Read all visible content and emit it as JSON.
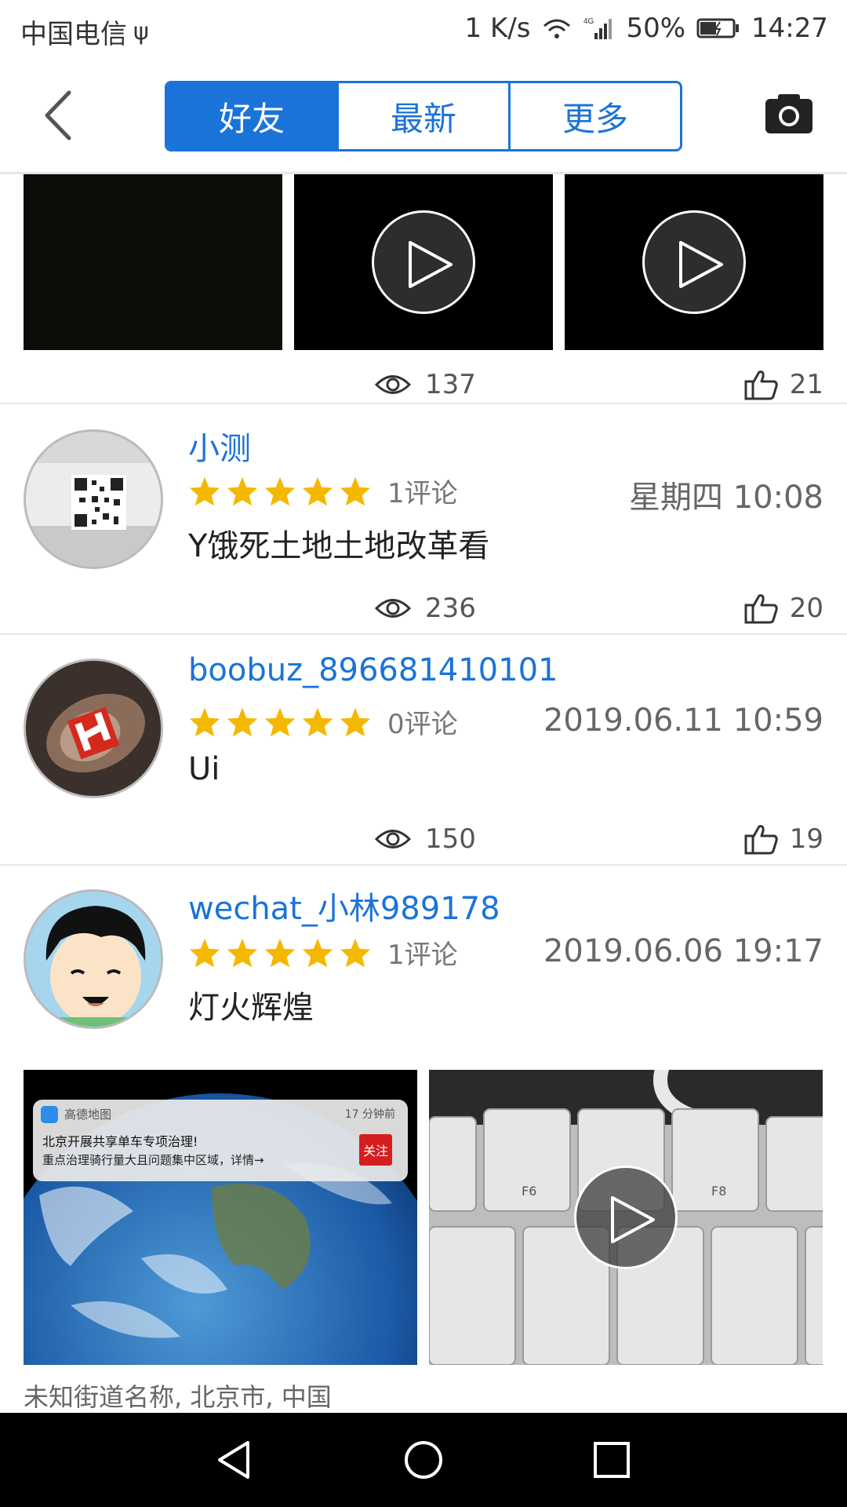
{
  "status_bar": {
    "carrier": "中国电信",
    "net_speed": "1 K/s",
    "network": "4G",
    "battery": "50%",
    "time": "14:27"
  },
  "header": {
    "tabs": [
      {
        "label": "好友",
        "active": true
      },
      {
        "label": "最新",
        "active": false
      },
      {
        "label": "更多",
        "active": false
      }
    ]
  },
  "colors": {
    "accent": "#1a73d9",
    "star": "#f5b800"
  },
  "feed": {
    "top_post_stats": {
      "views": "137",
      "likes": "21"
    },
    "posts": [
      {
        "username": "小测",
        "rating": 5,
        "comments": "1评论",
        "time": "星期四 10:08",
        "content": "Y饿死土地土地改革看",
        "views": "236",
        "likes": "20"
      },
      {
        "username": "boobuz_896681410101",
        "rating": 5,
        "comments": "0评论",
        "time": "2019.06.11 10:59",
        "content": "Ui",
        "views": "150",
        "likes": "19"
      },
      {
        "username": "wechat_小林989178",
        "rating": 5,
        "comments": "1评论",
        "time": "2019.06.06 19:17",
        "content": "灯火辉煌",
        "location": "未知街道名称, 北京市, 中国"
      }
    ],
    "notification": {
      "app": "高德地图",
      "ago": "17 分钟前",
      "line1": "北京开展共享单车专项治理!",
      "line2": "重点治理骑行量大且问题集中区域，详情→",
      "button": "关注"
    }
  }
}
